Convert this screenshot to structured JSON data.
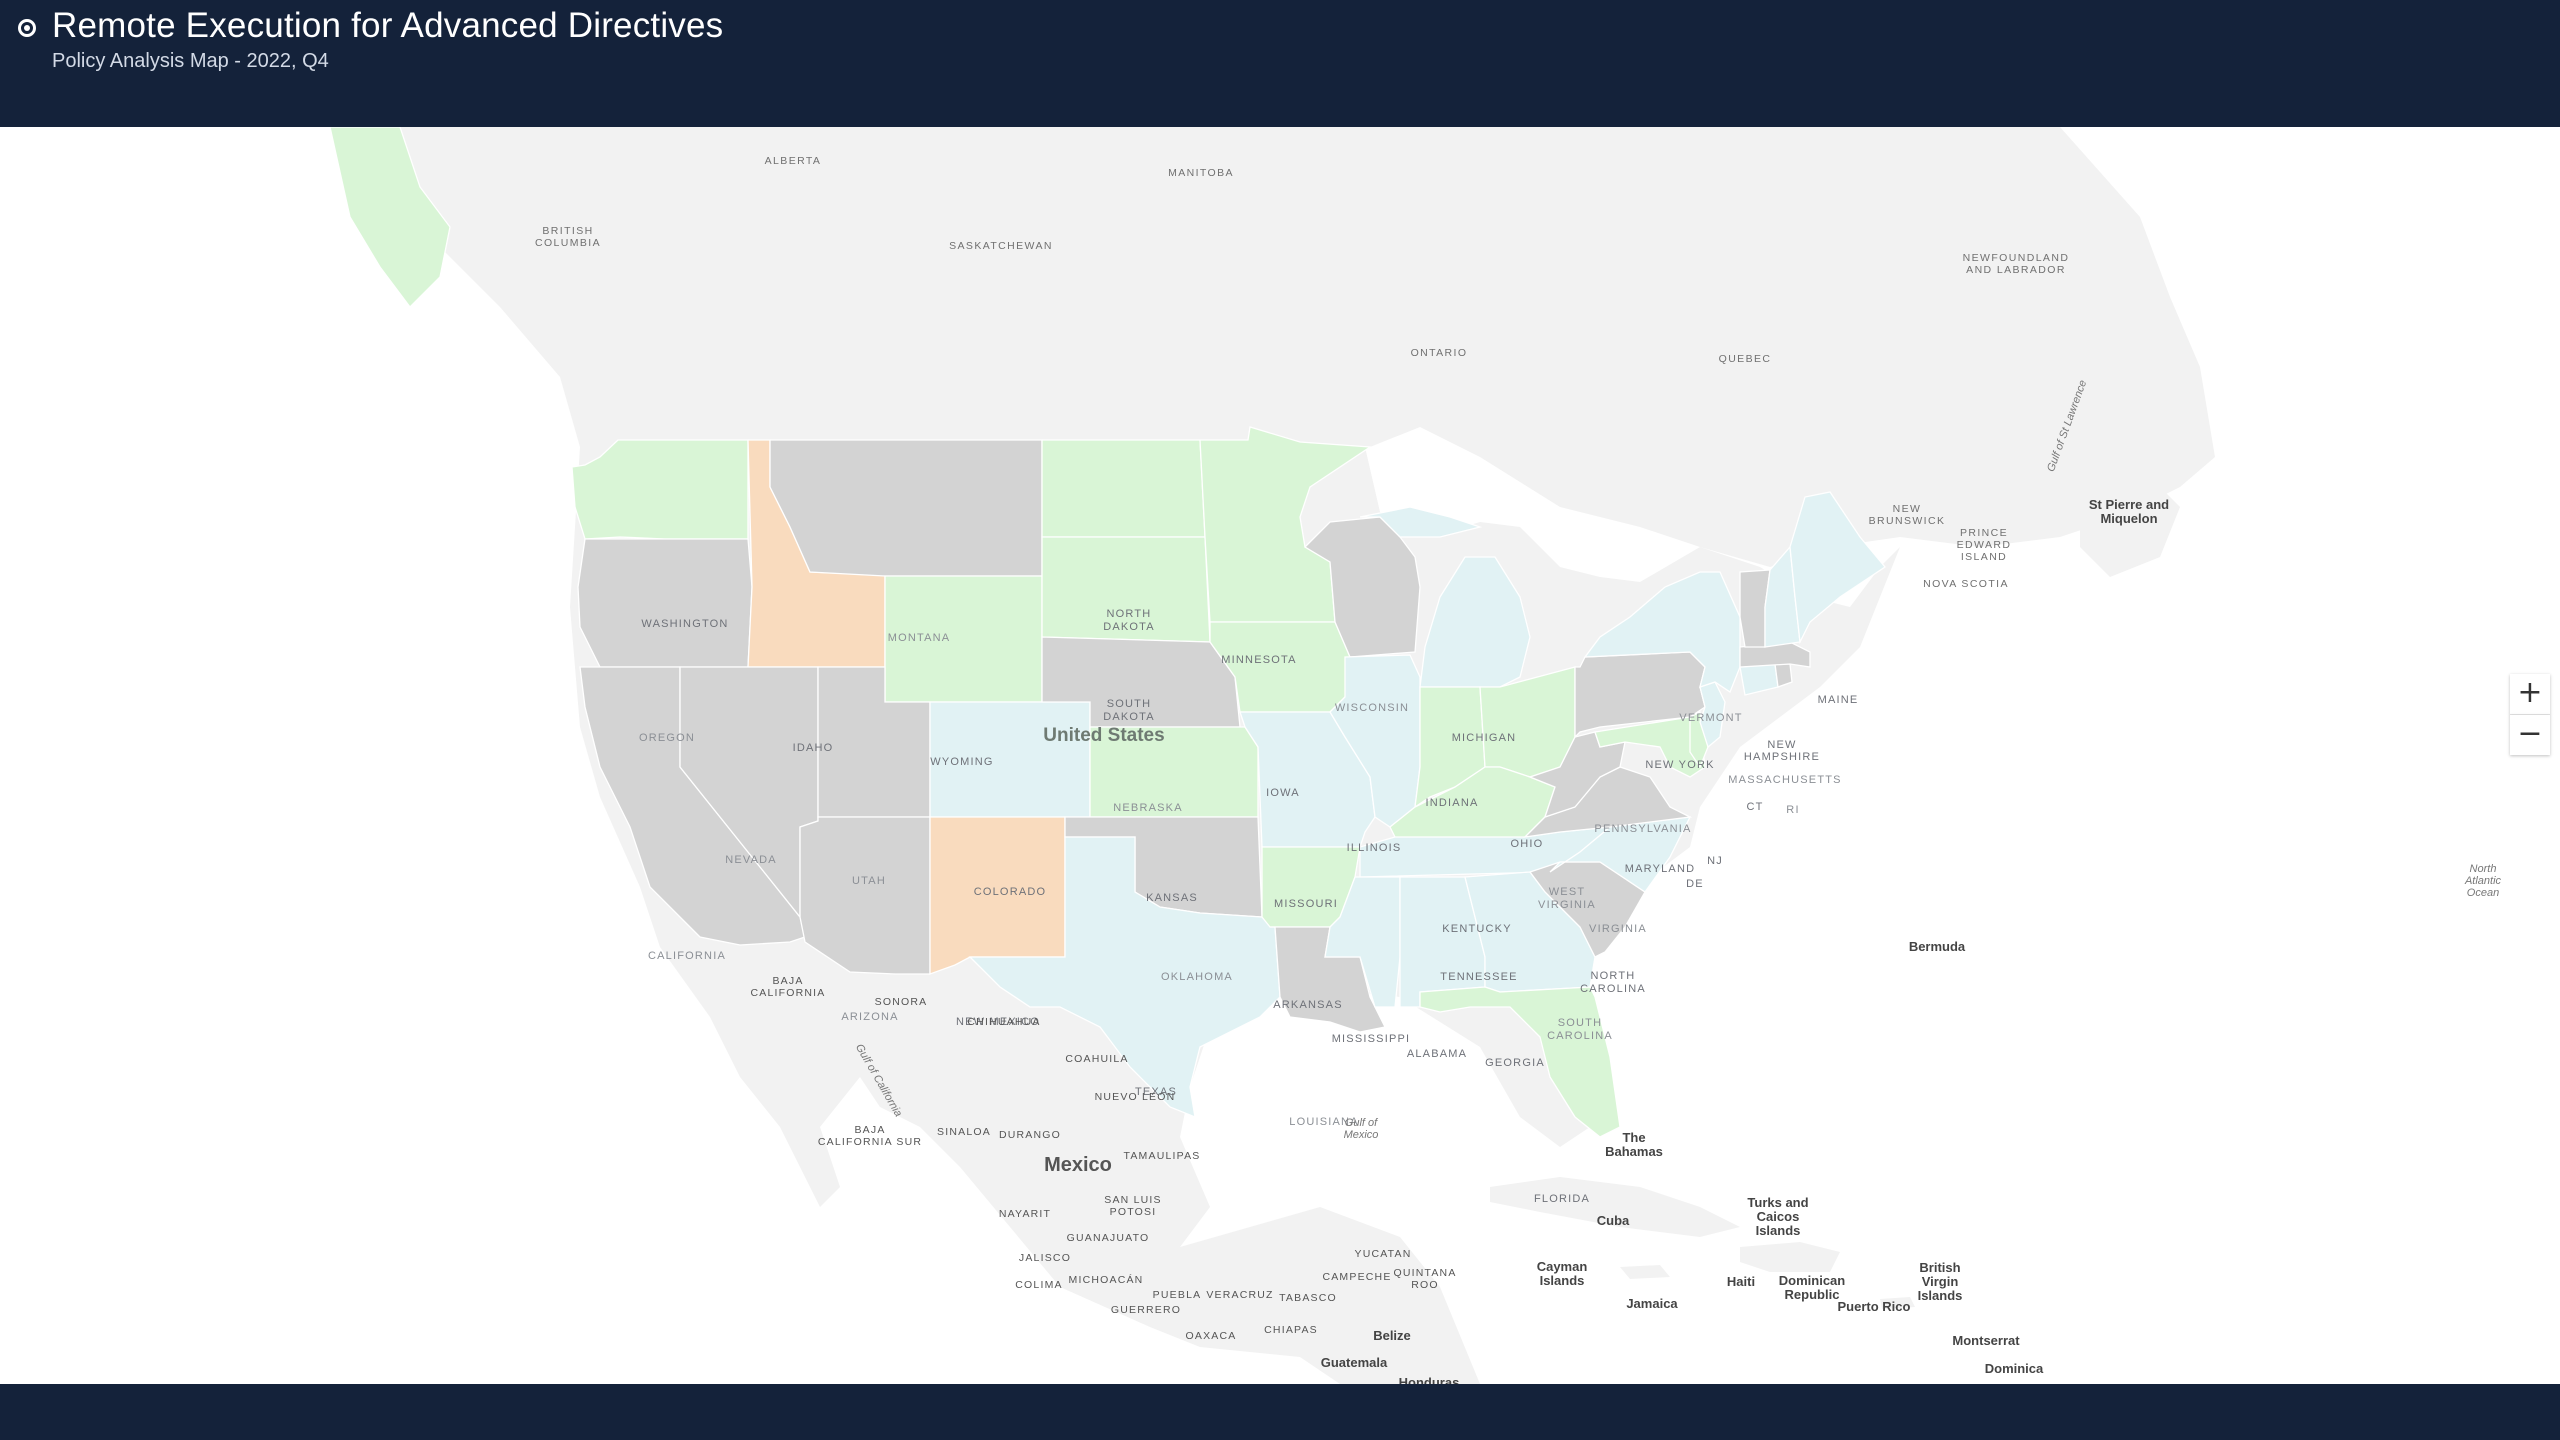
{
  "header": {
    "title": "Remote Execution for Advanced Directives",
    "subtitle": "Policy Analysis Map - 2022, Q4"
  },
  "colors": {
    "header_bg": "#14223a",
    "gray": "#d3d3d3",
    "green": "#d9f5d6",
    "blue": "#e1f2f4",
    "orange": "#f9dbbe",
    "land": "#f2f2f2"
  },
  "zoom": {
    "in_label": "+",
    "out_label": "−"
  },
  "map": {
    "country_labels": {
      "us": "United States",
      "mexico": "Mexico"
    },
    "states": [
      {
        "id": "WA",
        "label": "WASHINGTON",
        "category": "green"
      },
      {
        "id": "OR",
        "label": "OREGON",
        "category": "gray"
      },
      {
        "id": "CA",
        "label": "CALIFORNIA",
        "category": "gray"
      },
      {
        "id": "ID",
        "label": "IDAHO",
        "category": "orange"
      },
      {
        "id": "NV",
        "label": "NEVADA",
        "category": "gray"
      },
      {
        "id": "MT",
        "label": "MONTANA",
        "category": "gray"
      },
      {
        "id": "WY",
        "label": "WYOMING",
        "category": "green"
      },
      {
        "id": "UT",
        "label": "UTAH",
        "category": "gray"
      },
      {
        "id": "AZ",
        "label": "ARIZONA",
        "category": "gray"
      },
      {
        "id": "CO",
        "label": "COLORADO",
        "category": "blue"
      },
      {
        "id": "NM",
        "label": "NEW MEXICO",
        "category": "orange"
      },
      {
        "id": "ND",
        "label": "NORTH DAKOTA",
        "category": "green"
      },
      {
        "id": "SD",
        "label": "SOUTH DAKOTA",
        "category": "green"
      },
      {
        "id": "NE",
        "label": "NEBRASKA",
        "category": "gray"
      },
      {
        "id": "KS",
        "label": "KANSAS",
        "category": "green"
      },
      {
        "id": "OK",
        "label": "OKLAHOMA",
        "category": "gray"
      },
      {
        "id": "TX",
        "label": "TEXAS",
        "category": "blue"
      },
      {
        "id": "MN",
        "label": "MINNESOTA",
        "category": "green"
      },
      {
        "id": "IA",
        "label": "IOWA",
        "category": "green"
      },
      {
        "id": "MO",
        "label": "MISSOURI",
        "category": "blue"
      },
      {
        "id": "AR",
        "label": "ARKANSAS",
        "category": "green"
      },
      {
        "id": "LA",
        "label": "LOUISIANA",
        "category": "gray"
      },
      {
        "id": "WI",
        "label": "WISCONSIN",
        "category": "gray"
      },
      {
        "id": "IL",
        "label": "ILLINOIS",
        "category": "blue"
      },
      {
        "id": "MI",
        "label": "MICHIGAN",
        "category": "blue"
      },
      {
        "id": "IN",
        "label": "INDIANA",
        "category": "green"
      },
      {
        "id": "OH",
        "label": "OHIO",
        "category": "green"
      },
      {
        "id": "KY",
        "label": "KENTUCKY",
        "category": "green"
      },
      {
        "id": "TN",
        "label": "TENNESSEE",
        "category": "blue"
      },
      {
        "id": "MS",
        "label": "MISSISSIPPI",
        "category": "blue"
      },
      {
        "id": "AL",
        "label": "ALABAMA",
        "category": "blue"
      },
      {
        "id": "GA",
        "label": "GEORGIA",
        "category": "blue"
      },
      {
        "id": "FL",
        "label": "FLORIDA",
        "category": "green"
      },
      {
        "id": "SC",
        "label": "SOUTH CAROLINA",
        "category": "gray"
      },
      {
        "id": "NC",
        "label": "NORTH CAROLINA",
        "category": "blue"
      },
      {
        "id": "VA",
        "label": "VIRGINIA",
        "category": "gray"
      },
      {
        "id": "WV",
        "label": "WEST VIRGINIA",
        "category": "gray"
      },
      {
        "id": "PA",
        "label": "PENNSYLVANIA",
        "category": "gray"
      },
      {
        "id": "NY",
        "label": "NEW YORK",
        "category": "blue"
      },
      {
        "id": "MD",
        "label": "MARYLAND",
        "category": "green"
      },
      {
        "id": "DE",
        "label": "DE",
        "category": "green"
      },
      {
        "id": "NJ",
        "label": "NJ",
        "category": "blue"
      },
      {
        "id": "CT",
        "label": "CT",
        "category": "blue"
      },
      {
        "id": "RI",
        "label": "RI",
        "category": "gray"
      },
      {
        "id": "MA",
        "label": "MASSACHUSETTS",
        "category": "gray"
      },
      {
        "id": "VT",
        "label": "VERMONT",
        "category": "gray"
      },
      {
        "id": "NH",
        "label": "NEW HAMPSHIRE",
        "category": "blue"
      },
      {
        "id": "ME",
        "label": "MAINE",
        "category": "blue"
      }
    ],
    "canada_labels": [
      "ALBERTA",
      "MANITOBA",
      "BRITISH COLUMBIA",
      "SASKATCHEWAN",
      "ONTARIO",
      "QUEBEC",
      "NEWFOUNDLAND AND LABRADOR",
      "NEW BRUNSWICK",
      "PRINCE EDWARD ISLAND",
      "NOVA SCOTIA"
    ],
    "mexico_labels": [
      "BAJA CALIFORNIA",
      "SONORA",
      "CHIHUAHUA",
      "COAHUILA",
      "NUEVO LEON",
      "BAJA CALIFORNIA SUR",
      "SINALOA",
      "DURANGO",
      "TAMAULIPAS",
      "NAYARIT",
      "SAN LUIS POTOSI",
      "GUANAJUATO",
      "JALISCO",
      "MICHOACÁN",
      "COLIMA",
      "PUEBLA",
      "VERACRUZ",
      "GUERRERO",
      "OAXACA",
      "CHIAPAS",
      "TABASCO",
      "CAMPECHE",
      "YUCATAN",
      "QUINTANA ROO"
    ],
    "places": [
      "St Pierre and Miquelon",
      "Bermuda",
      "The Bahamas",
      "Cuba",
      "Turks and Caicos Islands",
      "Cayman Islands",
      "Jamaica",
      "Haiti",
      "Dominican Republic",
      "Puerto Rico",
      "British Virgin Islands",
      "Montserrat",
      "Dominica",
      "Belize",
      "Guatemala",
      "Honduras"
    ],
    "water_labels": [
      "Gulf of St Lawrence",
      "Gulf of California",
      "Gulf of Mexico",
      "North Atlantic Ocean"
    ]
  }
}
